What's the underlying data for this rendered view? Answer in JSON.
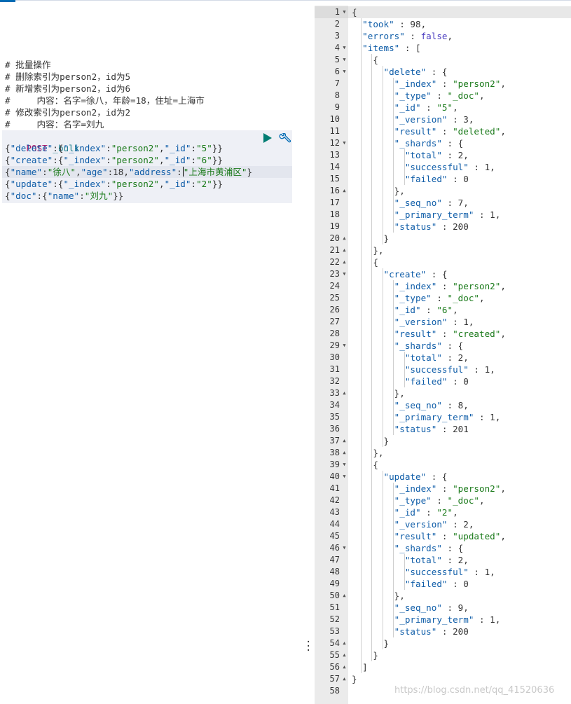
{
  "request": {
    "comments": [
      "# 批量操作",
      "# 删除索引为person2，id为5",
      "# 新增索引为person2，id为6",
      "#     内容：名字=徐八，年龄=18，住址=上海市",
      "# 修改索引为person2，id为2",
      "#     内容：名字=刘九"
    ],
    "method": "POST",
    "endpoint": "_bulk",
    "lines": [
      "{\"delete\":{\"_index\":\"person2\",\"_id\":\"5\"}}",
      "{\"create\":{\"_index\":\"person2\",\"_id\":\"6\"}}",
      "{\"name\":\"徐八\",\"age\":18,\"address\":\"上海市黄浦区\"}",
      "{\"update\":{\"_index\":\"person2\",\"_id\":\"2\"}}",
      "{\"doc\":{\"name\":\"刘九\"}}"
    ]
  },
  "response": {
    "lines": [
      "{",
      "  \"took\" : 98,",
      "  \"errors\" : false,",
      "  \"items\" : [",
      "    {",
      "      \"delete\" : {",
      "        \"_index\" : \"person2\",",
      "        \"_type\" : \"_doc\",",
      "        \"_id\" : \"5\",",
      "        \"_version\" : 3,",
      "        \"result\" : \"deleted\",",
      "        \"_shards\" : {",
      "          \"total\" : 2,",
      "          \"successful\" : 1,",
      "          \"failed\" : 0",
      "        },",
      "        \"_seq_no\" : 7,",
      "        \"_primary_term\" : 1,",
      "        \"status\" : 200",
      "      }",
      "    },",
      "    {",
      "      \"create\" : {",
      "        \"_index\" : \"person2\",",
      "        \"_type\" : \"_doc\",",
      "        \"_id\" : \"6\",",
      "        \"_version\" : 1,",
      "        \"result\" : \"created\",",
      "        \"_shards\" : {",
      "          \"total\" : 2,",
      "          \"successful\" : 1,",
      "          \"failed\" : 0",
      "        },",
      "        \"_seq_no\" : 8,",
      "        \"_primary_term\" : 1,",
      "        \"status\" : 201",
      "      }",
      "    },",
      "    {",
      "      \"update\" : {",
      "        \"_index\" : \"person2\",",
      "        \"_type\" : \"_doc\",",
      "        \"_id\" : \"2\",",
      "        \"_version\" : 2,",
      "        \"result\" : \"updated\",",
      "        \"_shards\" : {",
      "          \"total\" : 2,",
      "          \"successful\" : 1,",
      "          \"failed\" : 0",
      "        },",
      "        \"_seq_no\" : 9,",
      "        \"_primary_term\" : 1,",
      "        \"status\" : 200",
      "      }",
      "    }",
      "  ]",
      "}",
      ""
    ],
    "fold_open": [
      1,
      4,
      5,
      6,
      12,
      23,
      29,
      39,
      40,
      46
    ],
    "fold_close": [
      16,
      20,
      21,
      22,
      33,
      37,
      38,
      50,
      54,
      55,
      56,
      57
    ]
  },
  "watermark": "https://blog.csdn.net/qq_41520636",
  "colors": {
    "method": "#a7166b",
    "endpoint": "#1a7d8b",
    "key": "#0f5da8",
    "string": "#1a7a1a",
    "boolean": "#4a3cc0",
    "run": "#017d73",
    "settings": "#006bb4"
  },
  "icons": {
    "run": "play-icon",
    "settings": "wrench-icon",
    "resize": "vertical-dots-icon"
  }
}
